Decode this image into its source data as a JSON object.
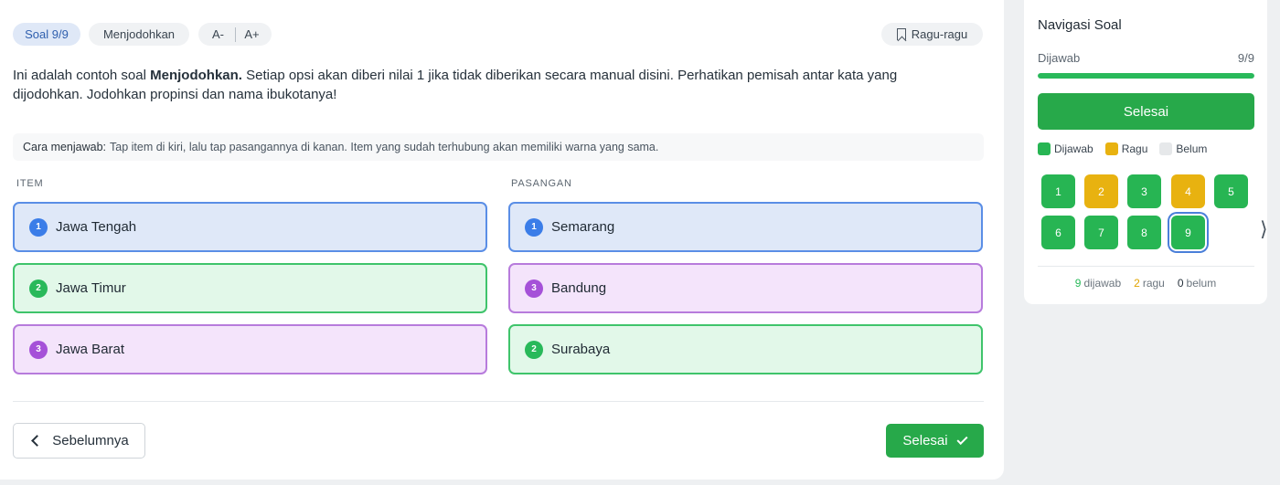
{
  "header": {
    "soal_label": "Soal 9/9",
    "type_label": "Menjodohkan",
    "font_minus": "A-",
    "font_plus": "A+",
    "ragu_label": "Ragu-ragu"
  },
  "question": {
    "prefix": "Ini adalah contoh soal ",
    "bold": "Menjodohkan.",
    "rest": " Setiap opsi akan diberi nilai 1 jika tidak diberikan secara manual disini. Perhatikan pemisah antar kata yang dijodohkan. Jodohkan propinsi dan nama ibukotanya!"
  },
  "howto": {
    "label": "Cara menjawab:",
    "text": "Tap item di kiri, lalu tap pasangannya di kanan. Item yang sudah terhubung akan memiliki warna yang sama."
  },
  "columns": {
    "item": "ITEM",
    "pair": "PASANGAN"
  },
  "items": [
    {
      "num": "1",
      "text": "Jawa Tengah",
      "color": "blue"
    },
    {
      "num": "2",
      "text": "Jawa Timur",
      "color": "green"
    },
    {
      "num": "3",
      "text": "Jawa Barat",
      "color": "purple"
    }
  ],
  "pairs": [
    {
      "num": "1",
      "text": "Semarang",
      "color": "blue"
    },
    {
      "num": "3",
      "text": "Bandung",
      "color": "purple"
    },
    {
      "num": "2",
      "text": "Surabaya",
      "color": "green"
    }
  ],
  "footer": {
    "prev_label": "Sebelumnya",
    "finish_label": "Selesai"
  },
  "sidebar": {
    "title": "Navigasi Soal",
    "answered_label": "Dijawab",
    "answered_count": "9/9",
    "progress_fraction": 1.0,
    "finish_label": "Selesai",
    "legend": [
      {
        "label": "Dijawab",
        "color": "#27b553"
      },
      {
        "label": "Ragu",
        "color": "#e8b210"
      },
      {
        "label": "Belum",
        "color": "#e6e8ea"
      }
    ],
    "questions": [
      {
        "n": "1",
        "state": "green"
      },
      {
        "n": "2",
        "state": "yellow"
      },
      {
        "n": "3",
        "state": "green"
      },
      {
        "n": "4",
        "state": "yellow"
      },
      {
        "n": "5",
        "state": "green"
      },
      {
        "n": "6",
        "state": "green"
      },
      {
        "n": "7",
        "state": "green"
      },
      {
        "n": "8",
        "state": "green"
      },
      {
        "n": "9",
        "state": "green",
        "current": true
      }
    ],
    "summary": {
      "answered_num": "9",
      "answered_text": "dijawab",
      "ragu_num": "2",
      "ragu_text": "ragu",
      "belum_num": "0",
      "belum_text": "belum"
    }
  },
  "colors": {
    "accent_green": "#27a94a",
    "blue": "#5a8ee6",
    "green": "#3fc46b",
    "purple": "#b77bdc"
  }
}
